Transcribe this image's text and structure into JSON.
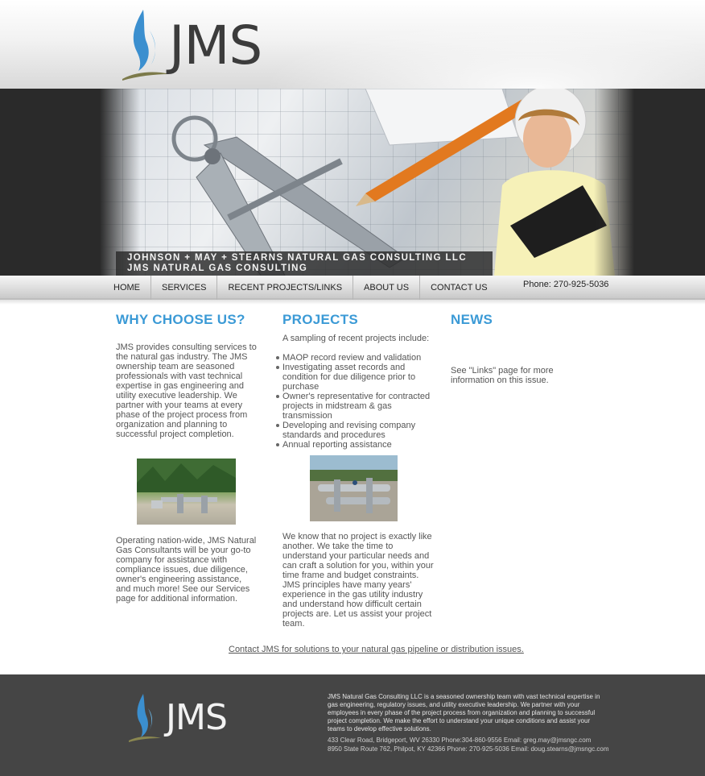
{
  "brand": {
    "logo_text": "JMS",
    "accent": "#3b9ad6",
    "flame_color": "#3b8fcf"
  },
  "banner": {
    "caption_line1": "JOHNSON + MAY + STEARNS NATURAL GAS CONSULTING LLC",
    "caption_line2": "JMS NATURAL GAS CONSULTING"
  },
  "nav": {
    "items": [
      {
        "label": "HOME"
      },
      {
        "label": "SERVICES"
      },
      {
        "label": "RECENT PROJECTS/LINKS"
      },
      {
        "label": "ABOUT US"
      },
      {
        "label": "CONTACT US"
      }
    ],
    "phone": "Phone: 270-925-5036"
  },
  "why": {
    "heading": "WHY CHOOSE US?",
    "para1": "JMS provides consulting services to the natural gas industry.  The JMS ownership team are seasoned professionals with vast technical expertise in gas engineering and utility executive leadership.  We partner with your teams at every phase of the project process from organization and planning to successful project completion.",
    "para2": "Operating nation-wide, JMS Natural Gas Consultants will be your go-to company for assistance with compliance issues, due diligence, owner's engineering assistance, and much more!  See our Services page for additional information."
  },
  "projects": {
    "heading": "PROJECTS",
    "lead": "A sampling of recent projects include:",
    "items": [
      "MAOP record review and validation",
      "Investigating asset records and condition for due diligence prior to purchase",
      "Owner's representative for contracted projects in midstream & gas transmission",
      "Developing and revising company standards and procedures",
      "Annual reporting assistance"
    ],
    "para": "We know that no project is exactly like another. We take the time to understand your particular needs and can craft a solution for you, within your time frame and budget constraints.  JMS principles have many years' experience in the gas utility industry and understand how difficult certain projects are.  Let us assist your project team."
  },
  "news": {
    "heading": "NEWS",
    "text": "See \"Links\" page for more information on this issue."
  },
  "contact_link": "Contact JMS for solutions to your natural gas pipeline or distribution issues.",
  "footer": {
    "about": "JMS Natural Gas Consulting LLC is a seasoned ownership team with vast technical expertise in gas engineering, regulatory issues, and utility executive leadership. We partner with your employees in every phase of the project process from organization and planning to successful project completion. We make the effort to understand your unique conditions and assist your teams to develop effective solutions.",
    "address1": "433 Clear Road, Bridgeport, WV 26330 Phone:304-860-9556 Email: greg.may@jmsngc.com",
    "address2": "8950 State Route 762, Philpot, KY 42366 Phone: 270-925-5036 Email: doug.stearns@jmsngc.com"
  }
}
